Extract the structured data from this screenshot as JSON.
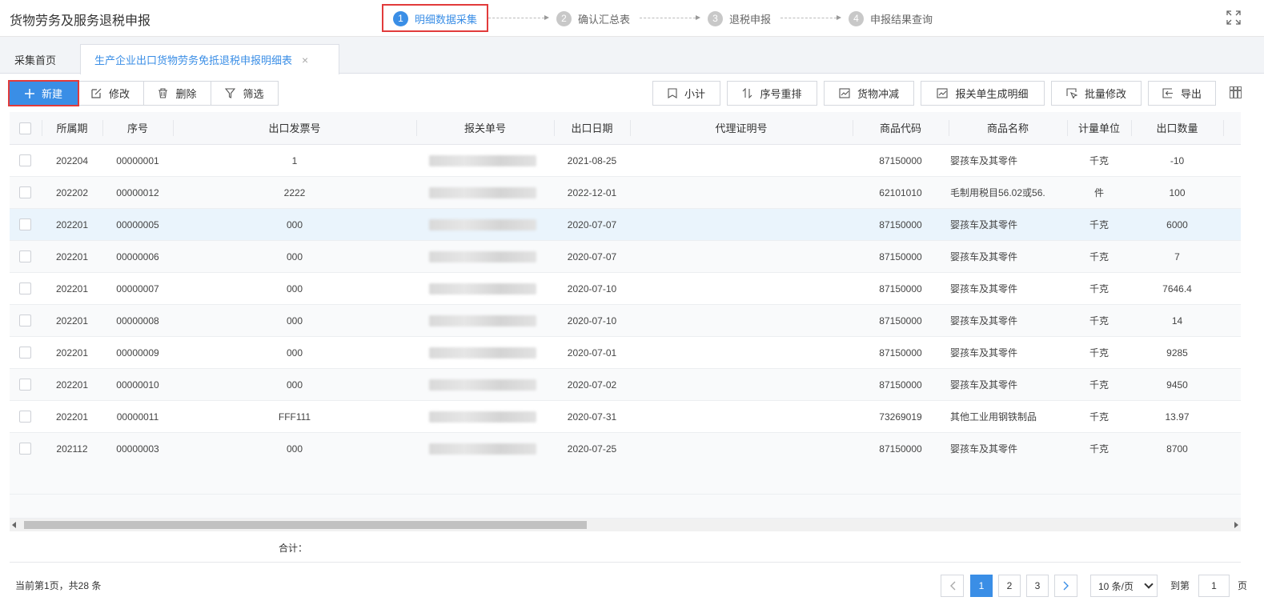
{
  "header": {
    "title": "货物劳务及服务退税申报",
    "steps": [
      {
        "num": "1",
        "label": "明细数据采集"
      },
      {
        "num": "2",
        "label": "确认汇总表"
      },
      {
        "num": "3",
        "label": "退税申报"
      },
      {
        "num": "4",
        "label": "申报结果查询"
      }
    ]
  },
  "tabs": {
    "home": "采集首页",
    "detail": "生产企业出口货物劳务免抵退税申报明细表",
    "close": "×"
  },
  "toolbar": {
    "new": "新建",
    "edit": "修改",
    "delete": "删除",
    "filter": "筛选",
    "subtotal": "小计",
    "reorder": "序号重排",
    "offset": "货物冲减",
    "generate": "报关单生成明细",
    "batch_edit": "批量修改",
    "export": "导出"
  },
  "table": {
    "columns": [
      "所属期",
      "序号",
      "出口发票号",
      "报关单号",
      "出口日期",
      "代理证明号",
      "商品代码",
      "商品名称",
      "计量单位",
      "出口数量"
    ],
    "rows": [
      {
        "period": "202204",
        "seq": "00000001",
        "invoice": "1",
        "date": "2021-08-25",
        "code": "87150000",
        "name": "婴孩车及其零件",
        "unit": "千克",
        "qty": "-10"
      },
      {
        "period": "202202",
        "seq": "00000012",
        "invoice": "2222",
        "date": "2022-12-01",
        "code": "62101010",
        "name": "毛制用税目56.02或56.",
        "unit": "件",
        "qty": "100"
      },
      {
        "period": "202201",
        "seq": "00000005",
        "invoice": "000",
        "date": "2020-07-07",
        "code": "87150000",
        "name": "婴孩车及其零件",
        "unit": "千克",
        "qty": "6000"
      },
      {
        "period": "202201",
        "seq": "00000006",
        "invoice": "000",
        "date": "2020-07-07",
        "code": "87150000",
        "name": "婴孩车及其零件",
        "unit": "千克",
        "qty": "7"
      },
      {
        "period": "202201",
        "seq": "00000007",
        "invoice": "000",
        "date": "2020-07-10",
        "code": "87150000",
        "name": "婴孩车及其零件",
        "unit": "千克",
        "qty": "7646.4"
      },
      {
        "period": "202201",
        "seq": "00000008",
        "invoice": "000",
        "date": "2020-07-10",
        "code": "87150000",
        "name": "婴孩车及其零件",
        "unit": "千克",
        "qty": "14"
      },
      {
        "period": "202201",
        "seq": "00000009",
        "invoice": "000",
        "date": "2020-07-01",
        "code": "87150000",
        "name": "婴孩车及其零件",
        "unit": "千克",
        "qty": "9285"
      },
      {
        "period": "202201",
        "seq": "00000010",
        "invoice": "000",
        "date": "2020-07-02",
        "code": "87150000",
        "name": "婴孩车及其零件",
        "unit": "千克",
        "qty": "9450"
      },
      {
        "period": "202201",
        "seq": "00000011",
        "invoice": "FFF111",
        "date": "2020-07-31",
        "code": "73269019",
        "name": "其他工业用钢铁制品",
        "unit": "千克",
        "qty": "13.97"
      },
      {
        "period": "202112",
        "seq": "00000003",
        "invoice": "000",
        "date": "2020-07-25",
        "code": "87150000",
        "name": "婴孩车及其零件",
        "unit": "千克",
        "qty": "8700"
      }
    ],
    "total_label": "合计："
  },
  "pagination": {
    "info": "当前第1页，共28 条",
    "pages": [
      "1",
      "2",
      "3"
    ],
    "per_page": "10 条/页",
    "goto_label": "到第",
    "goto_value": "1",
    "page_suffix": "页"
  }
}
